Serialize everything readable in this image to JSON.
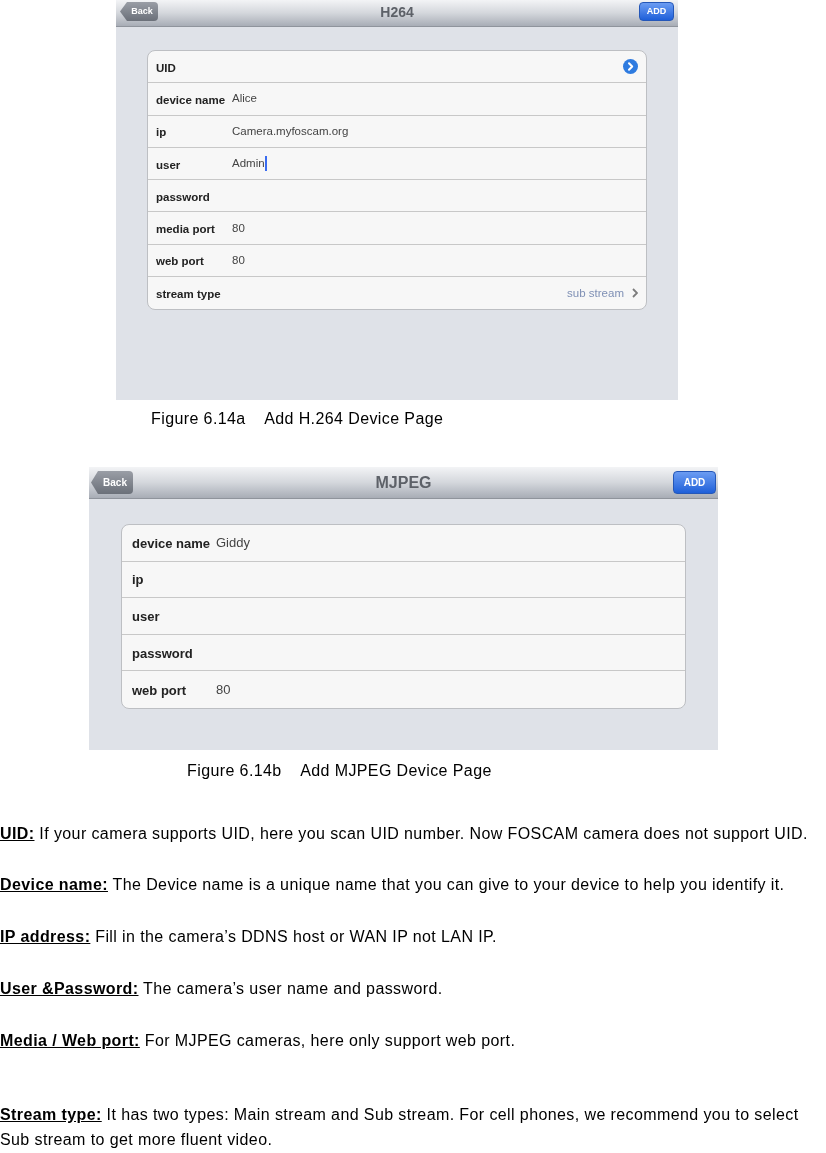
{
  "figures": [
    {
      "nav_bar": {
        "back_button": "Back",
        "title": "H264",
        "add_button": "ADD"
      },
      "form_rows": [
        {
          "kind": "disclosure",
          "label": "UID"
        },
        {
          "kind": "field",
          "label": "device name",
          "value": "Alice",
          "focused": false
        },
        {
          "kind": "field",
          "label": "ip",
          "value": "Camera.myfoscam.org",
          "focused": false
        },
        {
          "kind": "field",
          "label": "user",
          "value": "Admin",
          "focused": true
        },
        {
          "kind": "field",
          "label": "password",
          "focused": false
        },
        {
          "kind": "field",
          "label": "media port",
          "value": "80",
          "focused": false
        },
        {
          "kind": "field",
          "label": "web port",
          "value": "80",
          "focused": false
        },
        {
          "kind": "select",
          "label": "stream type",
          "value": "sub stream"
        }
      ],
      "caption": "Figure 6.14a    Add H.264 Device Page"
    },
    {
      "nav_bar": {
        "back_button": "Back",
        "title": "MJPEG",
        "add_button": "ADD"
      },
      "form_rows": [
        {
          "kind": "field",
          "label": "device name",
          "value": "Giddy",
          "focused": false
        },
        {
          "kind": "field",
          "label": "ip",
          "focused": false
        },
        {
          "kind": "field",
          "label": "user",
          "focused": false
        },
        {
          "kind": "field",
          "label": "password",
          "focused": false
        },
        {
          "kind": "field",
          "label": "web port",
          "value": "80",
          "focused": false
        }
      ],
      "caption": "Figure 6.14b    Add MJPEG Device Page"
    }
  ],
  "descriptions": [
    {
      "term": "UID:",
      "text": "If your camera supports UID, here you scan UID number. Now FOSCAM camera does not support UID."
    },
    {
      "term": "Device name:",
      "text": "The Device name is a unique name that you can give to your device to help you identify it."
    },
    {
      "term": "IP address:",
      "text": "Fill in the camera’s DDNS host or WAN IP not LAN IP."
    },
    {
      "term": "User &Password:",
      "text": "The camera’s user name and password."
    },
    {
      "term": "Media / Web port:",
      "text": "For MJPEG cameras, here only support web port."
    },
    {
      "term": "Stream type:",
      "text": "It has two types: Main stream and Sub stream. For cell phones, we recommend you to select Sub stream to get more fluent video."
    }
  ]
}
